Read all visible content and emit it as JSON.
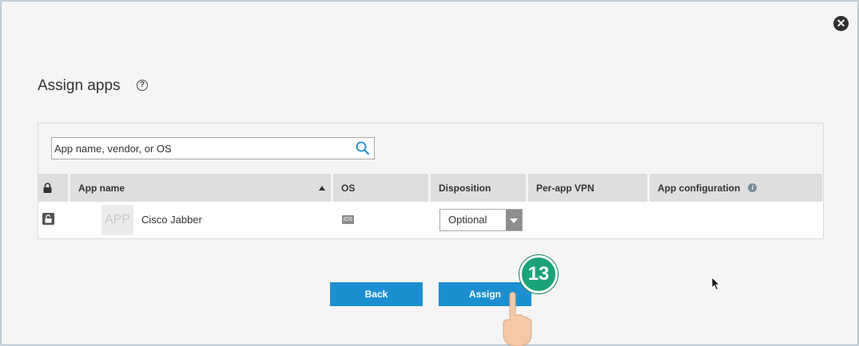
{
  "dialog": {
    "title": "Assign apps",
    "close_label": "✕"
  },
  "search": {
    "placeholder": "App name, vendor, or OS"
  },
  "table": {
    "columns": [
      "App name",
      "OS",
      "Disposition",
      "Per-app VPN",
      "App configuration"
    ],
    "rows": [
      {
        "icon_text": "APP",
        "app_name": "Cisco Jabber",
        "os": "iOS",
        "disposition": "Optional",
        "per_app_vpn": "",
        "app_configuration": ""
      }
    ]
  },
  "buttons": {
    "back": "Back",
    "assign": "Assign"
  },
  "overlay": {
    "step_number": "13"
  },
  "colors": {
    "primary_button": "#1c8fd0",
    "step_badge": "#1aa37a",
    "header_bg": "#dedede"
  }
}
